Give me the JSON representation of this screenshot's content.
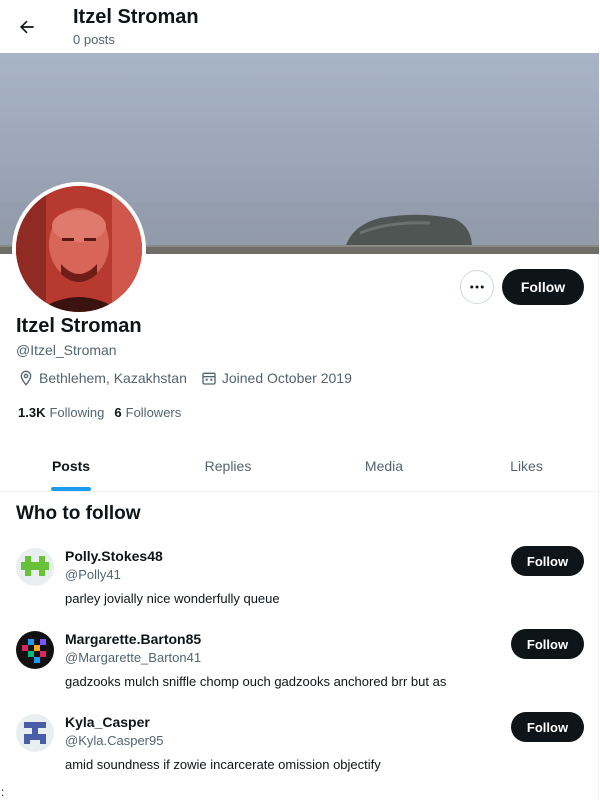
{
  "header": {
    "name": "Itzel Stroman",
    "post_count": "0 posts",
    "back_icon": "arrow-left-icon"
  },
  "profile": {
    "name": "Itzel Stroman",
    "handle": "@Itzel_Stroman",
    "location": "Bethlehem, Kazakhstan",
    "joined": "Joined October 2019",
    "following_count": "1.3K",
    "following_label": "Following",
    "followers_count": "6",
    "followers_label": "Followers",
    "follow_label": "Follow",
    "more_icon": "more-horizontal-icon"
  },
  "tabs": [
    {
      "label": "Posts",
      "active": true
    },
    {
      "label": "Replies",
      "active": false
    },
    {
      "label": "Media",
      "active": false
    },
    {
      "label": "Likes",
      "active": false
    }
  ],
  "who_to_follow": {
    "title": "Who to follow",
    "items": [
      {
        "name": "Polly.Stokes48",
        "handle": "@Polly41",
        "bio": "parley jovially nice wonderfully queue",
        "button": "Follow"
      },
      {
        "name": "Margarette.Barton85",
        "handle": "@Margarette_Barton41",
        "bio": "gadzooks mulch sniffle chomp ouch gadzooks anchored brr but as",
        "button": "Follow"
      },
      {
        "name": "Kyla_Casper",
        "handle": "@Kyla.Casper95",
        "bio": "amid soundness if zowie incarcerate omission objectify",
        "button": "Follow"
      }
    ]
  },
  "footer_mark": ":",
  "colors": {
    "accent": "#1d9bf0",
    "button_dark": "#0f1419",
    "muted_text": "#536471"
  }
}
